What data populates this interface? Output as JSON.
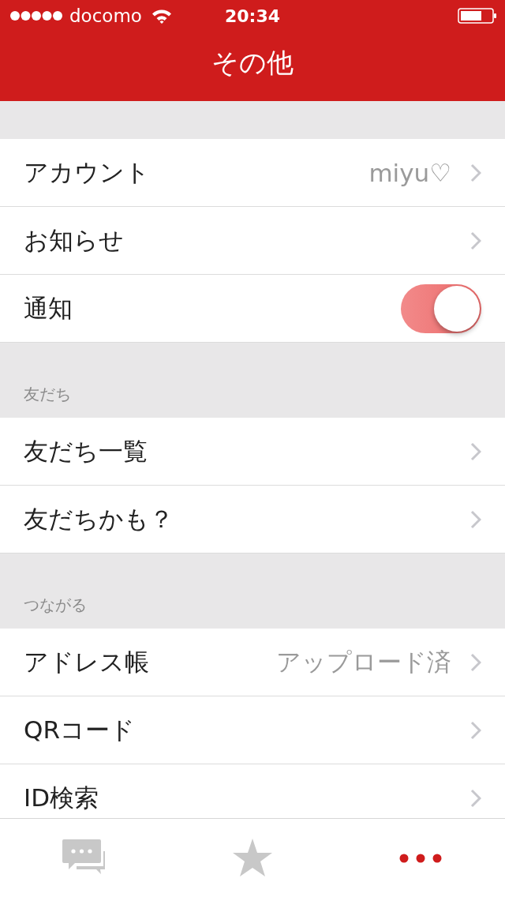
{
  "status_bar": {
    "carrier": "docomo",
    "time": "20:34"
  },
  "nav_bar": {
    "title": "その他"
  },
  "sections": [
    {
      "items": [
        {
          "kind": "link",
          "label": "アカウント",
          "value": "miyu♡"
        },
        {
          "kind": "link",
          "label": "お知らせ"
        },
        {
          "kind": "toggle",
          "label": "通知",
          "on": true
        }
      ]
    },
    {
      "header": "友だち",
      "items": [
        {
          "kind": "link",
          "label": "友だち一覧"
        },
        {
          "kind": "link",
          "label": "友だちかも？"
        }
      ]
    },
    {
      "header": "つながる",
      "items": [
        {
          "kind": "link",
          "label": "アドレス帳",
          "value": "アップロード済"
        },
        {
          "kind": "link",
          "label": "QRコード"
        },
        {
          "kind": "link",
          "label": "ID検索"
        }
      ]
    }
  ],
  "tab_bar": [
    {
      "kind": "chats",
      "selected": false
    },
    {
      "kind": "favorites",
      "selected": false
    },
    {
      "kind": "more",
      "selected": true
    }
  ]
}
